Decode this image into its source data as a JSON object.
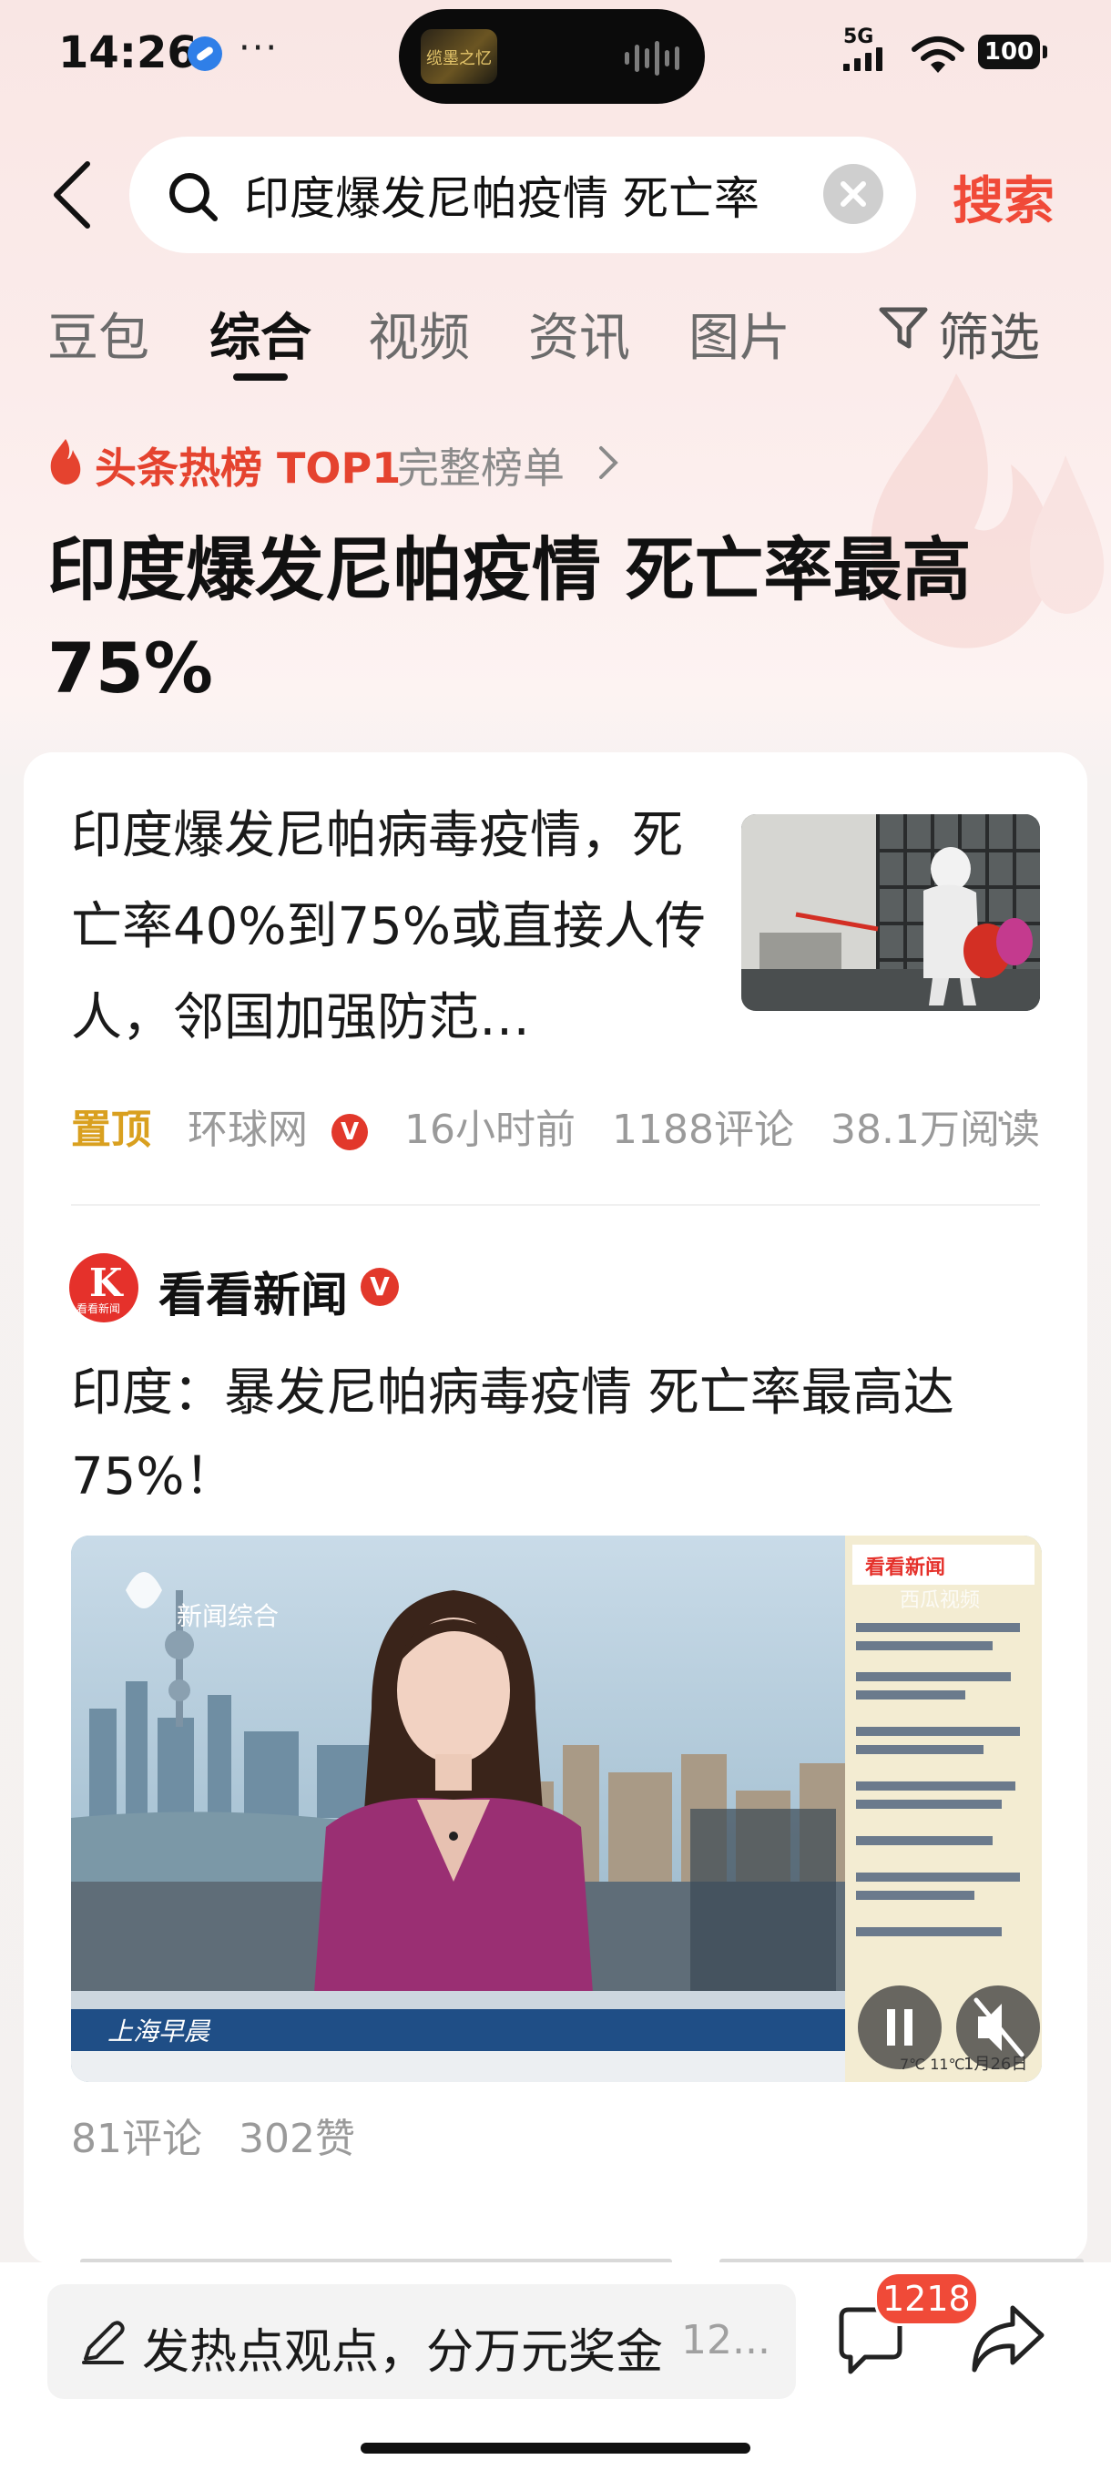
{
  "status_bar": {
    "time": "14:26",
    "dots": "···",
    "network": "5G",
    "battery": "100",
    "island_text": "缆墨之忆"
  },
  "search": {
    "query": "印度爆发尼帕疫情 死亡率",
    "button": "搜索"
  },
  "tabs": [
    {
      "label": "豆包",
      "active": false
    },
    {
      "label": "综合",
      "active": true
    },
    {
      "label": "视频",
      "active": false
    },
    {
      "label": "资讯",
      "active": false
    },
    {
      "label": "图片",
      "active": false
    }
  ],
  "filter": {
    "label": "筛选"
  },
  "hot_rank": {
    "label": "头条热榜 TOP1",
    "full_list": "完整榜单"
  },
  "headline": "印度爆发尼帕疫情 死亡率最高75%",
  "article1": {
    "title": "印度爆发尼帕病毒疫情，死亡率40%到75%或直接人传人，邻国加强防范…",
    "pinned": "置顶",
    "source": "环球网",
    "verified": "V",
    "time": "16小时前",
    "comments": "1188评论",
    "reads": "38.1万阅读",
    "more": "···"
  },
  "article2": {
    "source_name": "看看新闻",
    "source_logo": "K",
    "source_logo_sub": "看看新闻",
    "verified": "V",
    "title": "印度：暴发尼帕病毒疫情 死亡率最高达75%！",
    "video": {
      "channel_logo": "新闻综合",
      "program": "上海早晨",
      "watermark": "西瓜视频",
      "chat_header": "看看新闻",
      "weather": "7℃ 11℃",
      "date": "1月26日"
    },
    "comments": "81评论",
    "likes": "302赞"
  },
  "bottom_bar": {
    "comment_prompt": "发热点观点，分万元奖金",
    "comment_suffix": "12...",
    "badge_count": "1218"
  },
  "colors": {
    "accent": "#f04a38",
    "hot": "#e5432f",
    "pinned": "#d9a01f",
    "verified": "#e2382b"
  },
  "icons": [
    "back-icon",
    "search-icon",
    "clear-icon",
    "filter-icon",
    "flame-icon",
    "chevron-right-icon",
    "more-icon",
    "play-pause-icon",
    "mute-icon",
    "pen-icon",
    "comment-icon",
    "share-icon",
    "wifi-icon"
  ]
}
